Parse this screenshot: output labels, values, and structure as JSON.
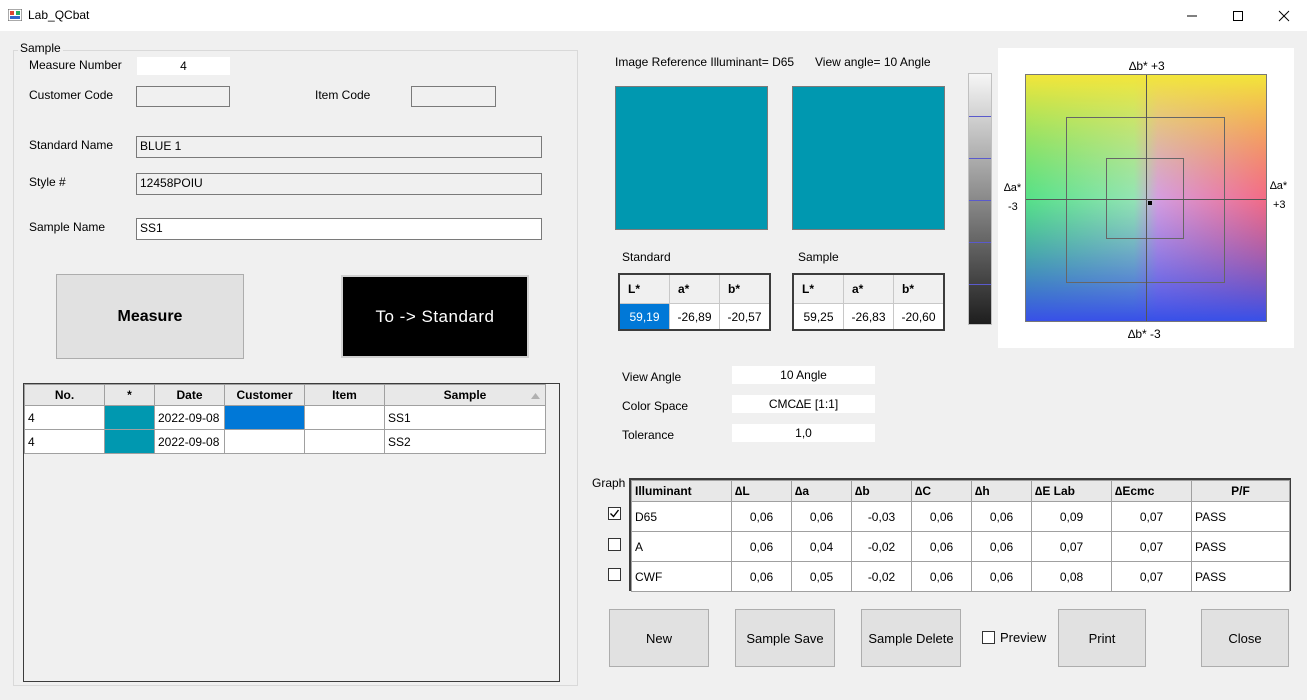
{
  "window": {
    "title": "Lab_QCbat",
    "minimize": "—",
    "maximize": "☐",
    "close": "✕"
  },
  "sample_group": {
    "caption": "Sample",
    "measure_number_label": "Measure Number",
    "measure_number": "4",
    "customer_code_label": "Customer Code",
    "customer_code": "",
    "item_code_label": "Item Code",
    "item_code": "",
    "standard_name_label": "Standard Name",
    "standard_name": "BLUE 1",
    "style_label": "Style #",
    "style": "12458POIU",
    "sample_name_label": "Sample Name",
    "sample_name": "SS1",
    "measure_button": "Measure",
    "to_standard_button": "To -> Standard",
    "table": {
      "headers": [
        "No.",
        "*",
        "Date",
        "Customer",
        "Item",
        "Sample"
      ],
      "sort_icon": "sort-up-icon",
      "rows": [
        {
          "no": "4",
          "color": "#0098b0",
          "date": "2022-09-08",
          "customer": "",
          "item": "",
          "sample": "SS1"
        },
        {
          "no": "4",
          "color": "#0098b0",
          "date": "2022-09-08",
          "customer": "",
          "item": "",
          "sample": "SS2"
        }
      ]
    }
  },
  "image_ref": {
    "illuminant": "Image Reference Illuminant= D65",
    "view_angle": "View angle= 10 Angle"
  },
  "colors": {
    "standard": "#0098b0",
    "sample": "#0098b0",
    "selected": "#0078d7"
  },
  "standard": {
    "label": "Standard",
    "headers": [
      "L*",
      "a*",
      "b*"
    ],
    "values": [
      "59,19",
      "-26,89",
      "-20,57"
    ]
  },
  "sample": {
    "label": "Sample",
    "headers": [
      "L*",
      "a*",
      "b*"
    ],
    "values": [
      "59,25",
      "-26,83",
      "-20,60"
    ]
  },
  "settings": {
    "view_angle_label": "View Angle",
    "view_angle": "10 Angle",
    "color_space_label": "Color Space",
    "color_space": "CMC∆E [1:1]",
    "tolerance_label": "Tolerance",
    "tolerance": "1,0"
  },
  "plot": {
    "top": "∆b* +3",
    "bottom": "∆b* -3",
    "left_a": "∆a*",
    "left_v": "-3",
    "right_a": "∆a*",
    "right_v": "+3"
  },
  "graph_label": "Graph",
  "results": {
    "headers": [
      "Illuminant",
      "∆L",
      "∆a",
      "∆b",
      "∆C",
      "∆h",
      "∆E Lab",
      "∆Ecmc",
      "P/F"
    ],
    "rows": [
      {
        "checked": true,
        "cells": [
          "D65",
          "0,06",
          "0,06",
          "-0,03",
          "0,06",
          "0,06",
          "0,09",
          "0,07",
          "PASS"
        ]
      },
      {
        "checked": false,
        "cells": [
          "A",
          "0,06",
          "0,04",
          "-0,02",
          "0,06",
          "0,06",
          "0,07",
          "0,07",
          "PASS"
        ]
      },
      {
        "checked": false,
        "cells": [
          "CWF",
          "0,06",
          "0,05",
          "-0,02",
          "0,06",
          "0,06",
          "0,08",
          "0,07",
          "PASS"
        ]
      }
    ]
  },
  "buttons": {
    "new": "New",
    "sample_save": "Sample Save",
    "sample_delete": "Sample Delete",
    "preview": "Preview",
    "print": "Print",
    "close": "Close"
  }
}
